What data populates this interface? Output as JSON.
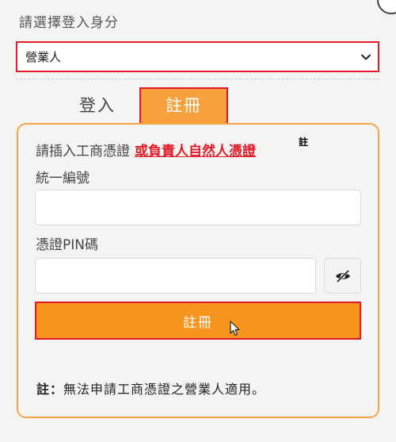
{
  "identity": {
    "label": "請選擇登入身分",
    "selected": "營業人"
  },
  "tabs": {
    "login": "登入",
    "register": "註冊"
  },
  "panel": {
    "instruction_prefix": "請插入工商憑證",
    "instruction_link": "或負責人自然人憑證",
    "note_mark": "註",
    "tax_id_label": "統一編號",
    "pin_label": "憑證PIN碼",
    "register_button": "註冊",
    "footnote_prefix": "註：",
    "footnote_text": "無法申請工商憑證之營業人適用。"
  },
  "icons": {
    "select_arrow": "chevron-down-icon",
    "password_toggle": "eye-slash-icon",
    "pointer": "cursor-pointer-icon"
  },
  "colors": {
    "accent": "#f7951f",
    "highlight_border": "#e21b2a",
    "panel_border": "#f5a54a",
    "link": "#e21b2a"
  }
}
